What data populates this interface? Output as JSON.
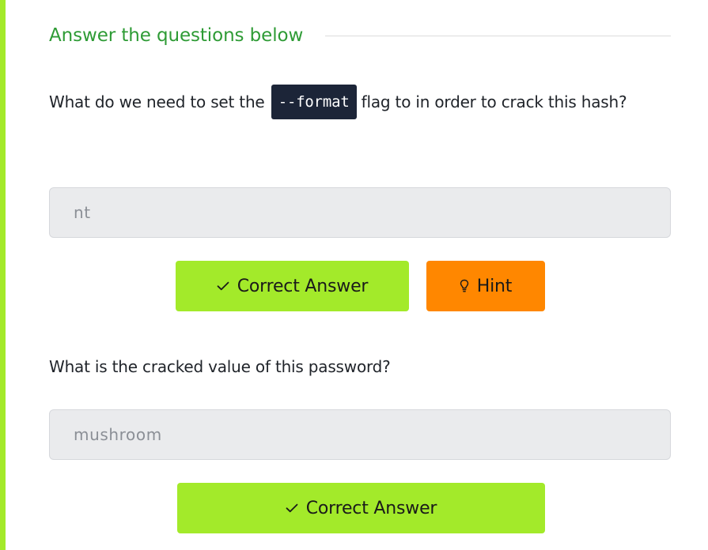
{
  "section": {
    "title": "Answer the questions below"
  },
  "questions": [
    {
      "text_before": "What do we need to set the",
      "code": "--format",
      "text_after": "flag to in order to crack this hash?",
      "answer": "nt",
      "correct_label": "Correct Answer",
      "hint_label": "Hint"
    },
    {
      "text": "What is the cracked value of this password?",
      "answer": "mushroom",
      "correct_label": "Correct Answer"
    }
  ],
  "colors": {
    "accent": "#a3ea2a",
    "title_green": "#2e9b35",
    "hint_orange": "#ff8700",
    "code_bg": "#1c2538"
  },
  "icons": {
    "correct": "check-icon",
    "hint": "lightbulb-icon"
  }
}
